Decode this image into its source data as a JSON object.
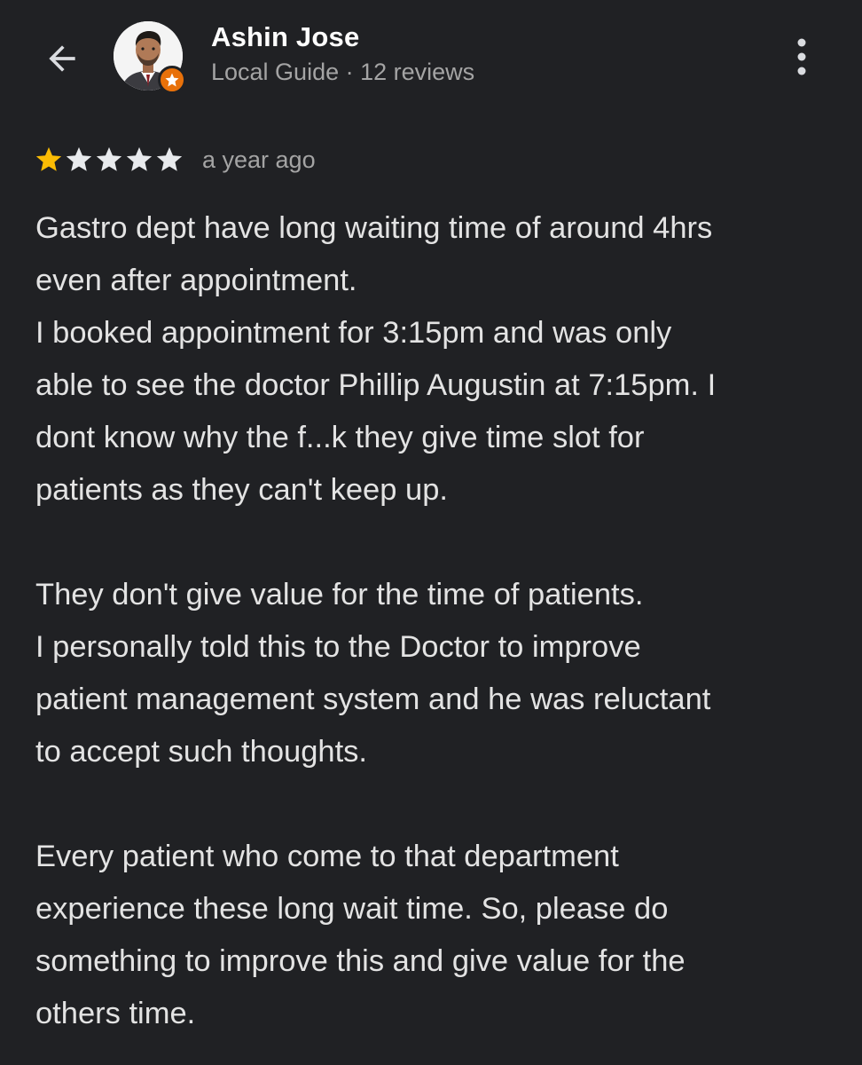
{
  "header": {
    "user_name": "Ashin Jose",
    "user_meta": "Local Guide · 12 reviews",
    "icons": {
      "back": "arrow-back-icon",
      "avatar": "avatar",
      "badge": "local-guide-badge-icon",
      "more": "more-vertical-icon"
    }
  },
  "review": {
    "rating": 1,
    "max_rating": 5,
    "time_ago": "a year ago",
    "text": "Gastro dept have long waiting time of around 4hrs\neven after appointment.\nI booked appointment for 3:15pm and was only\nable to see the doctor Phillip Augustin at 7:15pm. I\ndont know why the f...k they give time slot for\npatients as they can't keep up.\n\nThey don't give value for the time of patients.\nI personally told this to the Doctor to improve\npatient management system and he was reluctant\nto accept such thoughts.\n\nEvery patient who come to that department\nexperience these long wait time. So, please do\nsomething to improve this and give value for the\nothers time."
  },
  "colors": {
    "background": "#202124",
    "star_filled": "#fbbc04",
    "star_empty": "#e8eaed",
    "badge": "#e8710a",
    "secondary_text": "#a4a4a4"
  }
}
